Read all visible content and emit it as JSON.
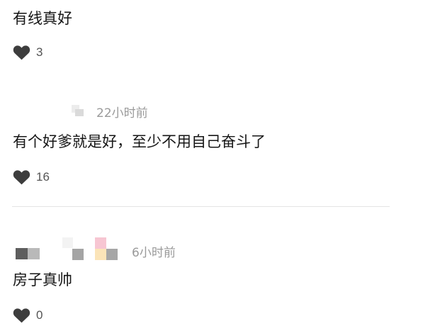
{
  "comments": [
    {
      "text": "有线真好",
      "likes": "3"
    },
    {
      "text": "有个好爹就是好，至少不用自己奋斗了",
      "timestamp": "22小时前",
      "likes": "16"
    },
    {
      "text": "房子真帅",
      "timestamp": "6小时前",
      "likes": "0"
    }
  ],
  "icons": {
    "like": "heart-icon"
  },
  "colors": {
    "heart": "#3d3d3d",
    "timestamp": "#9a9a9a",
    "divider": "#e4e4e4"
  }
}
